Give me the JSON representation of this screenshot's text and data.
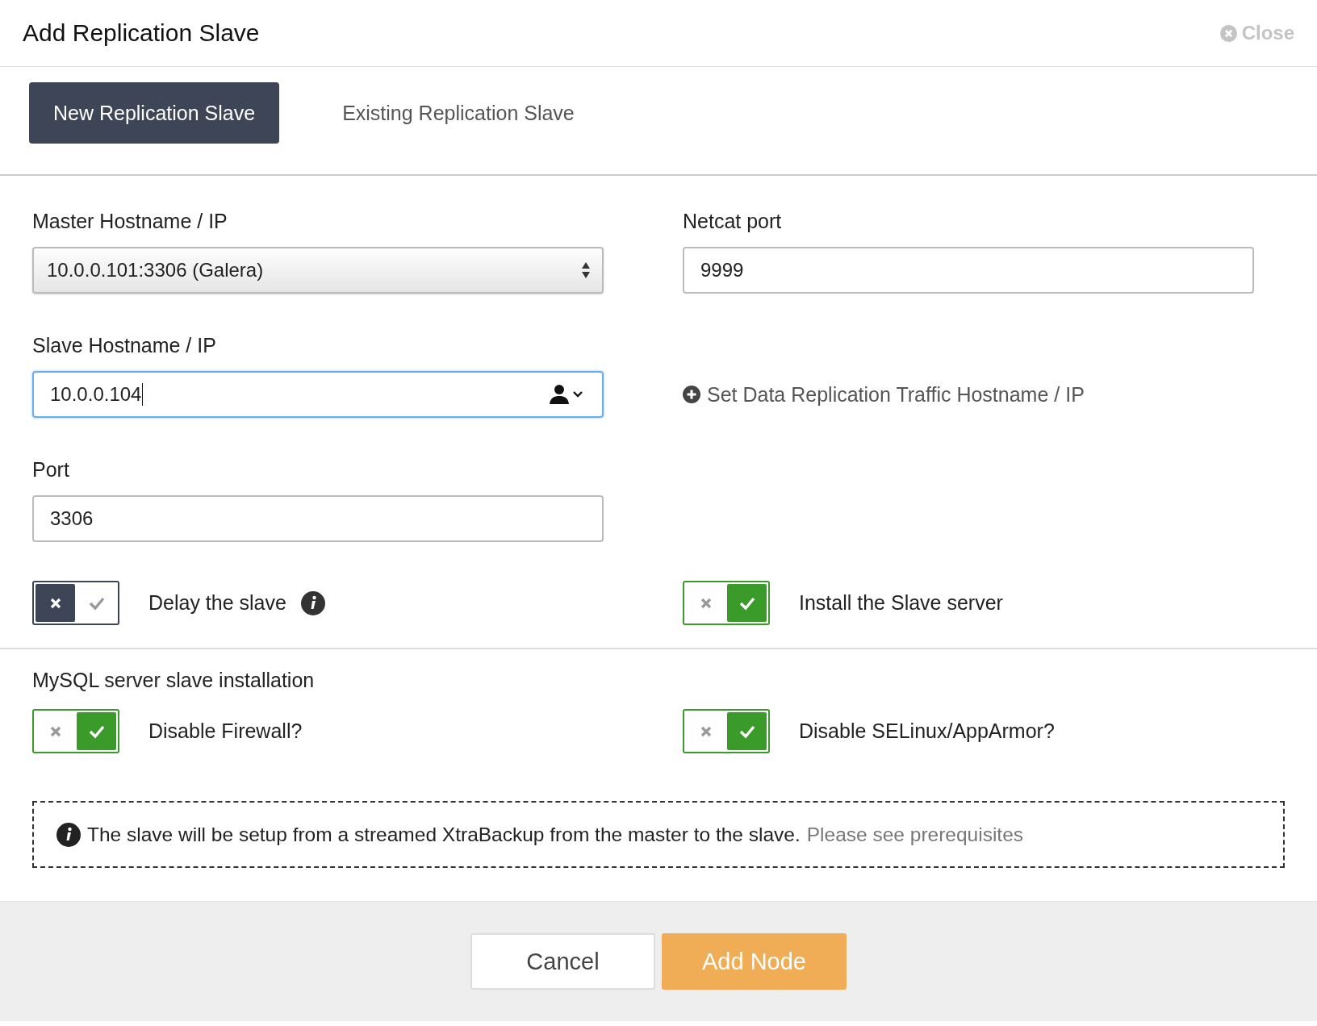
{
  "dialog": {
    "title": "Add Replication Slave",
    "close_label": "Close"
  },
  "tabs": [
    {
      "label": "New Replication Slave",
      "selected": true
    },
    {
      "label": "Existing Replication Slave",
      "selected": false
    }
  ],
  "master_hostname": {
    "label": "Master Hostname / IP",
    "value": "10.0.0.101:3306 (Galera)"
  },
  "netcat_port": {
    "label": "Netcat port",
    "value": "9999"
  },
  "slave_hostname": {
    "label": "Slave Hostname / IP",
    "value": "10.0.0.104",
    "focused": true
  },
  "traffic_link": "Set Data Replication Traffic Hostname / IP",
  "port": {
    "label": "Port",
    "value": "3306"
  },
  "toggles": [
    {
      "label": "Delay the slave",
      "on": false,
      "info": true
    },
    {
      "label": "Install the Slave server",
      "on": true,
      "info": false
    }
  ],
  "installation": {
    "title": "MySQL server slave installation",
    "toggles": [
      {
        "label": "Disable Firewall?",
        "on": true
      },
      {
        "label": "Disable SELinux/AppArmor?",
        "on": true
      }
    ]
  },
  "notice": {
    "text": "The slave will be setup from a streamed XtraBackup from the master to the slave.",
    "link": "Please see prerequisites"
  },
  "buttons": [
    {
      "label": "Cancel",
      "kind": "secondary"
    },
    {
      "label": "Add Node",
      "kind": "primary"
    }
  ]
}
